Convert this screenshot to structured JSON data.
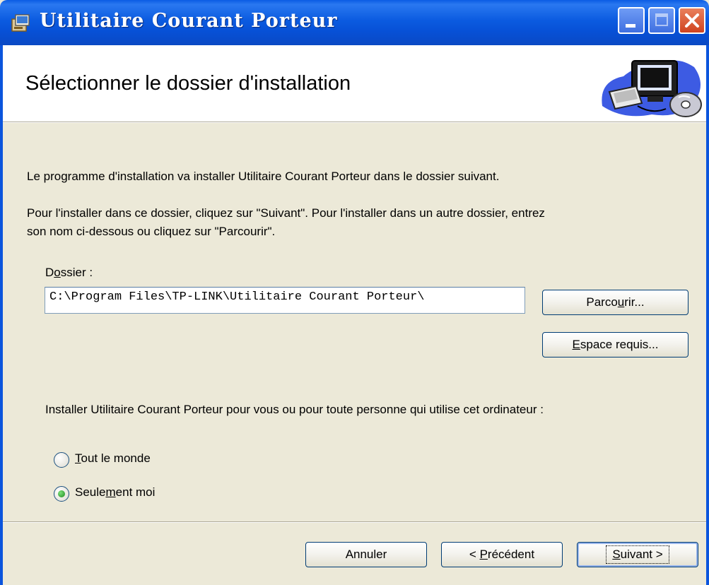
{
  "window": {
    "title": "Utilitaire Courant Porteur"
  },
  "header": {
    "title": "Sélectionner le dossier d'installation"
  },
  "body": {
    "description1": "Le programme d'installation va installer Utilitaire Courant Porteur  dans le dossier suivant.",
    "description2_line1": "Pour l'installer dans ce dossier, cliquez sur \"Suivant\". Pour l'installer dans un autre dossier, entrez",
    "description2_line2": "son nom ci-dessous ou cliquez sur \"Parcourir\".",
    "folder_label_pre": "D",
    "folder_label_accel": "o",
    "folder_label_post": "ssier :",
    "folder_path": "C:\\Program Files\\TP-LINK\\Utilitaire Courant Porteur\\",
    "browse_pre": "Parco",
    "browse_accel": "u",
    "browse_post": "rir...",
    "disk_cost_accel": "E",
    "disk_cost_post": "space requis...",
    "install_for_label": "Installer Utilitaire Courant Porteur  pour vous ou pour toute personne qui utilise cet ordinateur :",
    "option_everyone_accel": "T",
    "option_everyone_post": "out le monde",
    "option_me_pre": "Seule",
    "option_me_accel": "m",
    "option_me_post": "ent moi",
    "selected_option": "Seulement moi"
  },
  "footer": {
    "cancel_label": "Annuler",
    "prev_pre": "< ",
    "prev_accel": "P",
    "prev_post": "récédent",
    "next_accel": "S",
    "next_post": "uivant >"
  },
  "colors": {
    "titlebar": "#0a5ce4",
    "dialog_bg": "#ece9d8",
    "close_button": "#d0431f"
  }
}
